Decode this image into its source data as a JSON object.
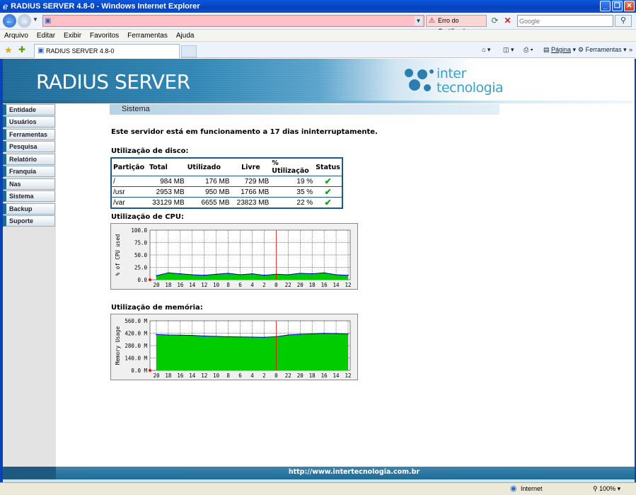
{
  "window": {
    "title": "RADIUS SERVER 4.8-0 - Windows Internet Explorer",
    "url": "",
    "cert_error": "Erro do Certificado",
    "search_placeholder": "Google"
  },
  "menu": [
    "Arquivo",
    "Editar",
    "Exibir",
    "Favoritos",
    "Ferramentas",
    "Ajuda"
  ],
  "tab": {
    "label": "RADIUS SERVER 4.8-0"
  },
  "commands": {
    "page": "Página",
    "tools": "Ferramentas"
  },
  "banner": {
    "title": "RADIUS SERVER",
    "logo_line1": "inter",
    "logo_line2": "tecnologia"
  },
  "sidebar": {
    "items": [
      "Entidade",
      "Usuários",
      "Ferramentas",
      "Pesquisa",
      "Relatório",
      "Franquia",
      "Nas",
      "Sistema",
      "Backup",
      "Suporte"
    ]
  },
  "main": {
    "section_title": "Sistema",
    "uptime": "Este servidor está em funcionamento a 17 dias ininterruptamente.",
    "disk_label": "Utilização de disco:",
    "cpu_label": "Utilização de CPU:",
    "mem_label": "Utilização de memória:"
  },
  "disk": {
    "headers": [
      "Partição",
      "Total",
      "Utilizado",
      "Livre",
      "% Utilização",
      "Status"
    ],
    "rows": [
      [
        "/",
        "984 MB",
        "176 MB",
        "729 MB",
        "19 %",
        "✔"
      ],
      [
        "/usr",
        "2953 MB",
        "950 MB",
        "1766 MB",
        "35 %",
        "✔"
      ],
      [
        "/var",
        "33129 MB",
        "6655 MB",
        "23823 MB",
        "22 %",
        "✔"
      ]
    ]
  },
  "cpu_graph": {
    "ylabel": "% of CPU used",
    "yticks": [
      "100.0",
      "75.0",
      "50.0",
      "25.0",
      "0.0"
    ],
    "xticks": [
      "20",
      "18",
      "16",
      "14",
      "12",
      "10",
      "8",
      "6",
      "4",
      "2",
      "0",
      "22",
      "20",
      "18",
      "16",
      "14",
      "12"
    ],
    "colors": {
      "fill": "#00cc00",
      "line": "#0000cc",
      "grid": "#000000",
      "now": "#ff0000"
    }
  },
  "mem_graph": {
    "ylabel": "Memory Usage",
    "yticks": [
      "560.0 M",
      "420.0 M",
      "280.0 M",
      "140.0 M",
      "0.0 M"
    ],
    "xticks": [
      "20",
      "18",
      "16",
      "14",
      "12",
      "10",
      "8",
      "6",
      "4",
      "2",
      "0",
      "22",
      "20",
      "18",
      "16",
      "14",
      "12"
    ],
    "colors": {
      "fill": "#00cc00",
      "line": "#0000cc",
      "now": "#ff0000"
    }
  },
  "footer": {
    "url": "http://www.intertecnologia.com.br"
  },
  "status": {
    "zone": "Internet",
    "zoom": "100%"
  },
  "chart_data": [
    {
      "type": "area",
      "title": "Utilização de CPU:",
      "ylabel": "% of CPU used",
      "ylim": [
        0,
        100
      ],
      "x": [
        "20",
        "18",
        "16",
        "14",
        "12",
        "10",
        "8",
        "6",
        "4",
        "2",
        "0",
        "22",
        "20",
        "18",
        "16",
        "14",
        "12"
      ],
      "series": [
        {
          "values": [
            8,
            14,
            12,
            10,
            9,
            11,
            13,
            10,
            12,
            9,
            11,
            10,
            13,
            12,
            14,
            10,
            9
          ]
        }
      ]
    },
    {
      "type": "area",
      "title": "Utilização de memória:",
      "ylabel": "Memory Usage",
      "ylim": [
        0,
        560
      ],
      "x": [
        "20",
        "18",
        "16",
        "14",
        "12",
        "10",
        "8",
        "6",
        "4",
        "2",
        "0",
        "22",
        "20",
        "18",
        "16",
        "14",
        "12"
      ],
      "series": [
        {
          "values": [
            405,
            400,
            398,
            395,
            388,
            384,
            380,
            378,
            376,
            374,
            380,
            400,
            408,
            412,
            418,
            415,
            410
          ]
        }
      ]
    }
  ]
}
